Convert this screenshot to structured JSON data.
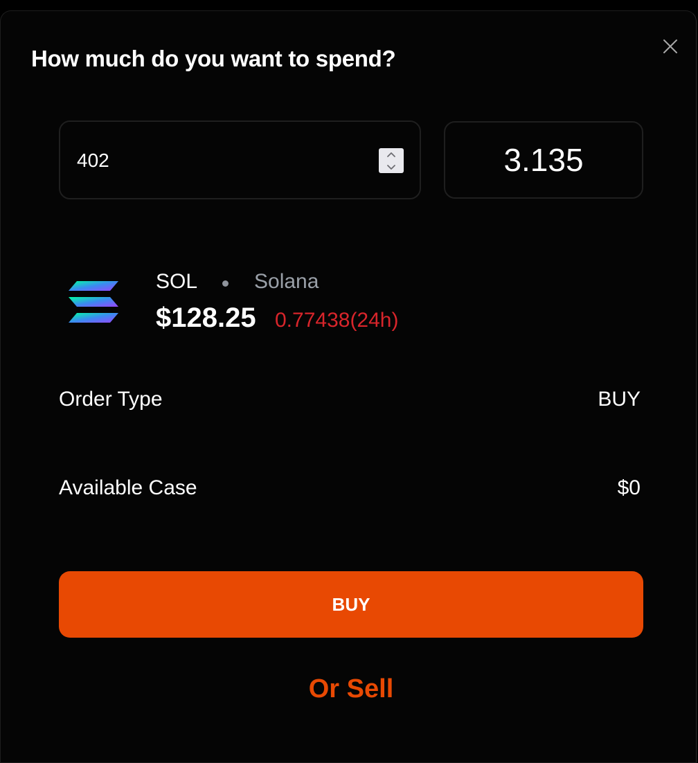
{
  "modal": {
    "title": "How much do you want to spend?",
    "close_icon": "close-icon"
  },
  "amount": {
    "value": "402",
    "spinner_icon": "stepper-arrows-icon"
  },
  "quantity": {
    "value": "3.135"
  },
  "token": {
    "logo_icon": "solana-logo-icon",
    "symbol": "SOL",
    "name": "Solana",
    "price": "$128.25",
    "change": "0.77438(24h)",
    "change_color": "#d8252b"
  },
  "order": {
    "type_label": "Order Type",
    "type_value": "BUY",
    "available_label": "Available Case",
    "available_value": "$0"
  },
  "actions": {
    "buy_label": "BUY",
    "sell_label": "Or Sell"
  },
  "colors": {
    "accent": "#e84903",
    "background": "#050505",
    "negative": "#d8252b"
  }
}
